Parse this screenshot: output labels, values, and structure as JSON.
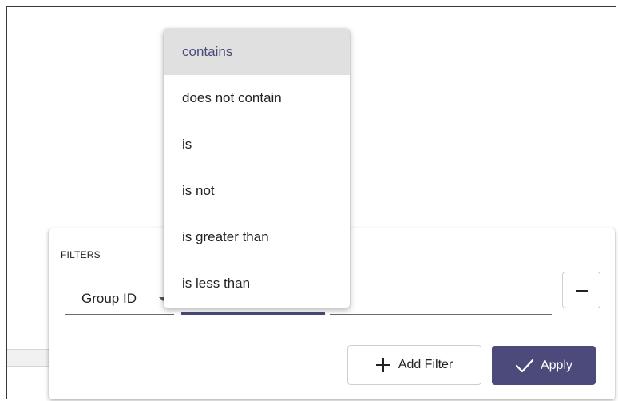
{
  "filters_panel": {
    "title": "FILTERS",
    "column_value": "Group ID",
    "add_filter_label": "Add Filter",
    "apply_label": "Apply"
  },
  "operator_menu": {
    "selected": "contains",
    "options": [
      "contains",
      "does not contain",
      "is",
      "is not",
      "is greater than",
      "is less than"
    ]
  },
  "colors": {
    "accent": "#4b4a7a",
    "selected_bg": "#e0e0e0"
  },
  "icons": [
    "chevron-down-icon",
    "minus-icon",
    "plus-icon",
    "check-icon"
  ]
}
